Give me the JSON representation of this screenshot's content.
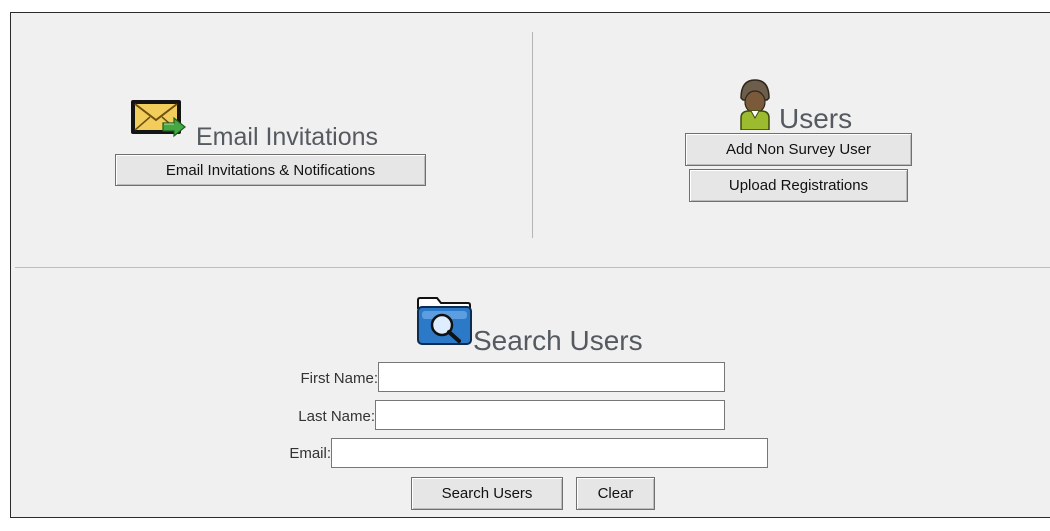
{
  "email_section": {
    "icon": "envelope-icon",
    "heading": "Email Invitations",
    "button_label": "Email Invitations & Notifications"
  },
  "users_section": {
    "icon": "user-icon",
    "heading": "Users",
    "add_button_label": "Add Non Survey User",
    "upload_button_label": "Upload Registrations"
  },
  "search_section": {
    "icon": "folder-search-icon",
    "heading": "Search Users",
    "first_name": {
      "label": "First Name:",
      "value": ""
    },
    "last_name": {
      "label": "Last Name:",
      "value": ""
    },
    "email": {
      "label": "Email:",
      "value": ""
    },
    "search_button_label": "Search Users",
    "clear_button_label": "Clear"
  }
}
